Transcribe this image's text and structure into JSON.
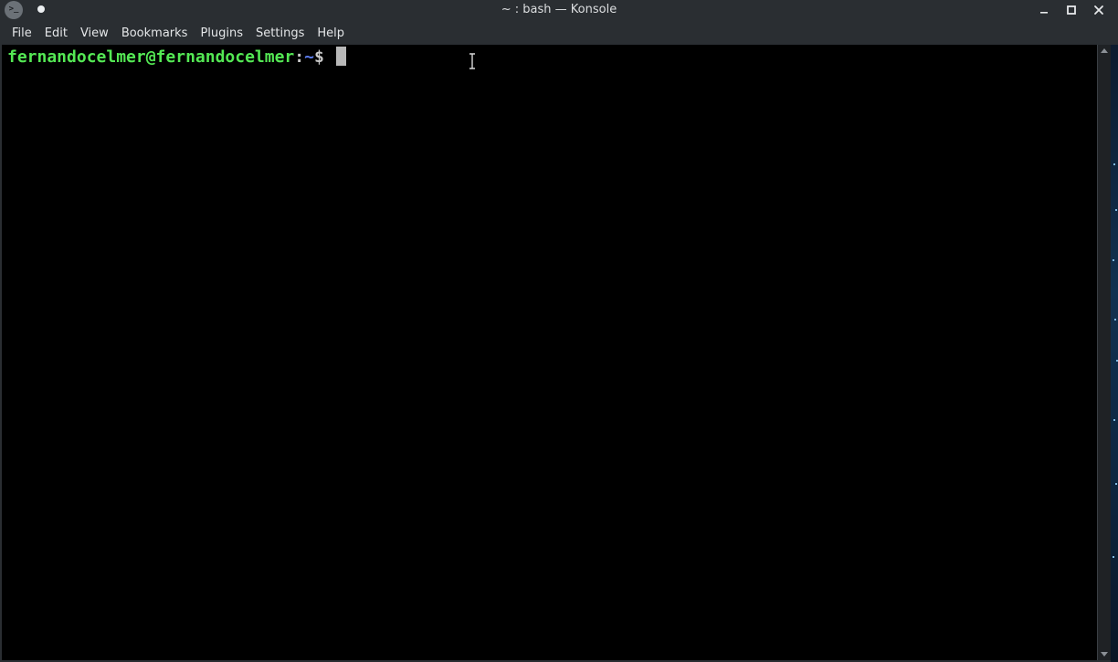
{
  "window": {
    "title": "~ : bash — Konsole",
    "app_icon_glyph": ">_"
  },
  "menu": {
    "items": [
      "File",
      "Edit",
      "View",
      "Bookmarks",
      "Plugins",
      "Settings",
      "Help"
    ]
  },
  "terminal": {
    "user_host": "fernandocelmer@fernandocelmer",
    "colon": ":",
    "path": "~",
    "prompt_symbol": "$ ",
    "colors": {
      "user_host": "#54e854",
      "path": "#5b7cf0",
      "background": "#000000"
    }
  },
  "icons": {
    "minimize": "minimize-icon",
    "maximize": "maximize-icon",
    "close": "close-icon",
    "pin": "pin-icon",
    "app": "konsole-icon"
  }
}
